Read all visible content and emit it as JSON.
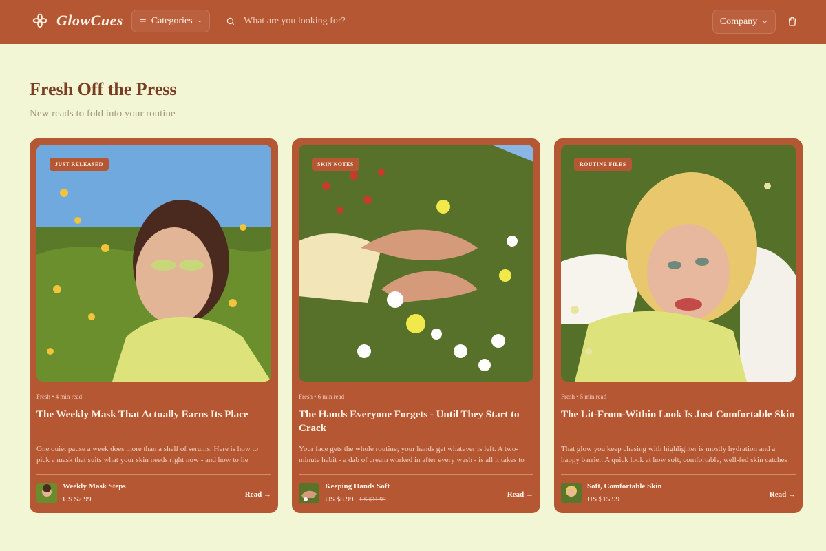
{
  "header": {
    "brand": "GlowCues",
    "categories_label": "Categories",
    "search_placeholder": "What are you looking for?",
    "company_label": "Company",
    "icons": [
      "flower-logo-icon",
      "menu-lines-icon",
      "chevron-down-icon",
      "search-icon",
      "bag-icon"
    ]
  },
  "section": {
    "title": "Fresh Off the Press",
    "subtitle": "New reads to fold into your routine"
  },
  "cards": [
    {
      "badge": "JUST RELEASED",
      "meta": "Fresh • 4 min read",
      "title": "The Weekly Mask That Actually Earns Its Place",
      "description": "One quiet pause a week does more than a shelf of serums. Here is how to pick a mask that suits what your skin needs right now - and how to lie",
      "product_name": "Weekly Mask Steps",
      "price": "US $2.99",
      "old_price": "",
      "cta": "Read →"
    },
    {
      "badge": "SKIN NOTES",
      "meta": "Fresh • 6 min read",
      "title": "The Hands Everyone Forgets - Until They Start to Crack",
      "description": "Your face gets the whole routine; your hands get whatever is left. A two-minute habit - a dab of cream worked in after every wash - is all it takes to",
      "product_name": "Keeping Hands Soft",
      "price": "US $8.99",
      "old_price": "US $11.99",
      "cta": "Read →"
    },
    {
      "badge": "ROUTINE FILES",
      "meta": "Fresh • 5 min read",
      "title": "The Lit-From-Within Look Is Just Comfortable Skin",
      "description": "That glow you keep chasing with highlighter is mostly hydration and a happy barrier. A quick look at how soft, comfortable, well-fed skin catches",
      "product_name": "Soft, Comfortable Skin",
      "price": "US $15.99",
      "old_price": "",
      "cta": "Read →"
    }
  ],
  "colors": {
    "primary": "#B65734",
    "background": "#F2F6D4",
    "headline": "#7A3E25",
    "text": "#FFF3E6"
  }
}
